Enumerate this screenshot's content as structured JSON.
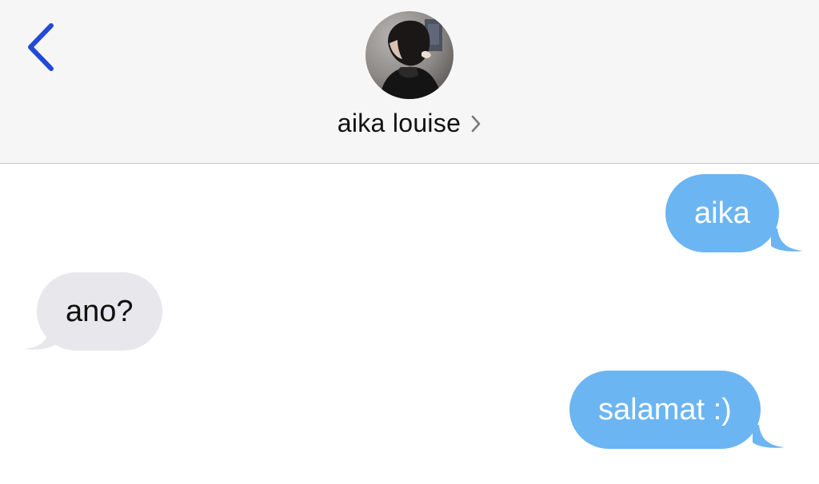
{
  "header": {
    "contact_name": "aika louise",
    "back_icon": "chevron-left-icon",
    "detail_icon": "chevron-right-icon",
    "accent_color": "#2349d8"
  },
  "messages": [
    {
      "direction": "sent",
      "text": "aika"
    },
    {
      "direction": "received",
      "text": "ano?"
    },
    {
      "direction": "sent",
      "text": "salamat :)"
    }
  ],
  "colors": {
    "sent_bubble": "#6bb5f2",
    "received_bubble": "#e8e8ec",
    "header_background": "#f6f6f6"
  }
}
